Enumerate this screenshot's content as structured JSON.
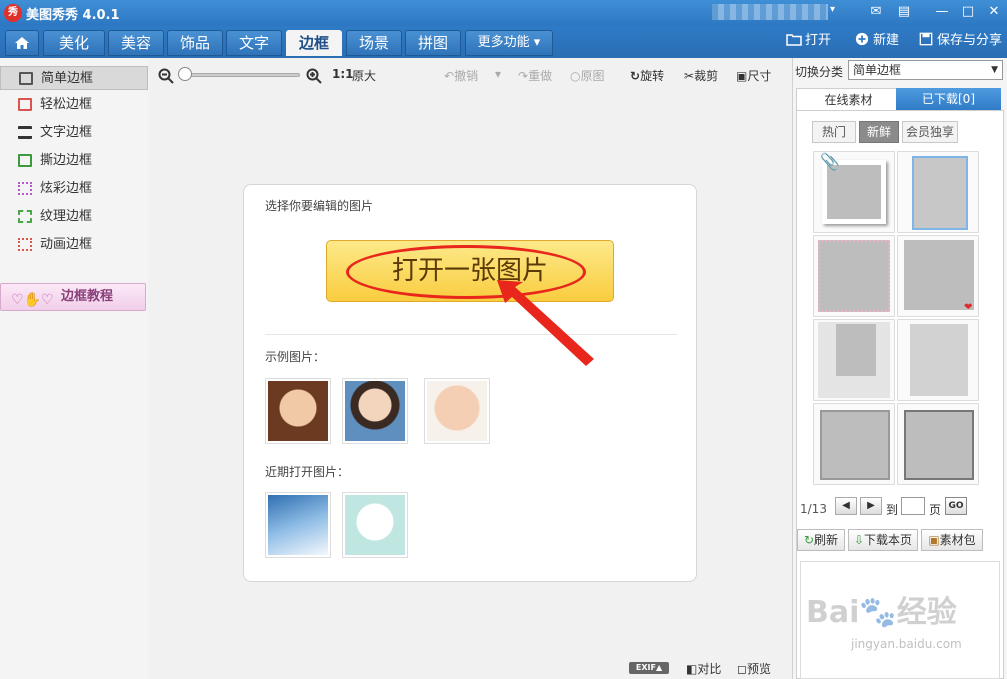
{
  "titlebar": {
    "logo_text": "秀",
    "title": "美图秀秀 4.0.1",
    "user_caret": "▾",
    "icons": [
      "feedback-icon",
      "skin-icon",
      "minimize-icon",
      "maximize-icon",
      "close-icon"
    ]
  },
  "tabs": {
    "items": [
      {
        "label": "美化"
      },
      {
        "label": "美容"
      },
      {
        "label": "饰品"
      },
      {
        "label": "文字"
      },
      {
        "label": "边框",
        "active": true
      },
      {
        "label": "场景"
      },
      {
        "label": "拼图"
      },
      {
        "label": "更多功能 ▾"
      }
    ],
    "open_label": "打开",
    "new_label": "新建",
    "save_share_label": "保存与分享"
  },
  "sidebar": {
    "items": [
      {
        "label": "简单边框",
        "active": true,
        "icon": "simple-frame-icon",
        "color": "#555555"
      },
      {
        "label": "轻松边框",
        "icon": "easy-frame-icon",
        "color": "#d9534f"
      },
      {
        "label": "文字边框",
        "icon": "text-frame-icon",
        "color": "#333333"
      },
      {
        "label": "撕边边框",
        "icon": "torn-frame-icon",
        "color": "#3c9a3c"
      },
      {
        "label": "炫彩边框",
        "icon": "colorful-frame-icon",
        "color": "#b05bc9"
      },
      {
        "label": "纹理边框",
        "icon": "texture-frame-icon",
        "color": "#48a548"
      },
      {
        "label": "动画边框",
        "icon": "animated-frame-icon",
        "color": "#d9534f"
      }
    ],
    "tutorial_label": "边框教程"
  },
  "toolbar": {
    "ratio_label": "1:1",
    "original_size_label": "原大",
    "undo_label": "撤销",
    "redo_label": "重做",
    "original_label": "原图",
    "rotate_label": "旋转",
    "crop_label": "裁剪",
    "size_label": "尺寸"
  },
  "main": {
    "card_title": "选择你要编辑的图片",
    "open_button_label": "打开一张图片",
    "sample_label": "示例图片：",
    "recent_label": "近期打开图片：",
    "sample_images": [
      "sample-photo-woman-bangs",
      "sample-photo-woman-denim",
      "sample-photo-baby"
    ],
    "recent_images": [
      "recent-photo-blue-sky",
      "recent-photo-cartoon"
    ]
  },
  "statusbar": {
    "exif_label": "EXIF▲",
    "compare_label": "对比",
    "preview_label": "预览"
  },
  "right_panel": {
    "switch_label": "切换分类",
    "category_value": "简单边框",
    "tab_online": "在线素材",
    "tab_downloaded": "已下载[0]",
    "pills": [
      {
        "label": "热门"
      },
      {
        "label": "新鲜",
        "active": true
      },
      {
        "label": "会员独享"
      }
    ],
    "page_text": "1/13",
    "prev_label": "◀",
    "next_label": "▶",
    "to_label": "到",
    "page_unit": "页",
    "go_label": "GO",
    "refresh_label": "刷新",
    "download_page_label": "下载本页",
    "material_pack_label": "素材包",
    "watermark": "Bai🐾经验",
    "watermark_sub": "jingyan.baidu.com"
  },
  "colors": {
    "accent_blue": "#2f7bc6",
    "highlight_red": "#e8261c",
    "button_yellow": "#f9cd3f"
  }
}
